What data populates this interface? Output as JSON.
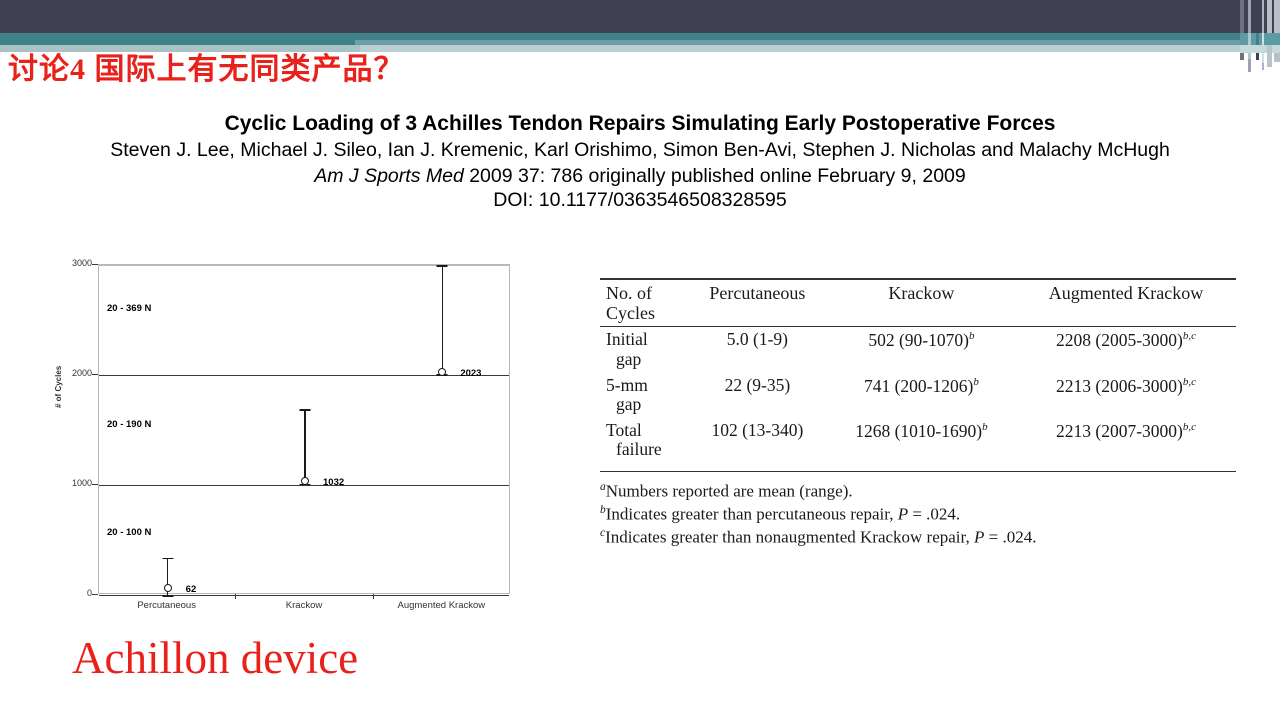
{
  "header": {
    "band_navy_color": "#3f4051",
    "band_teal_color": "#3e8189",
    "band_pale_color": "#a9c2c6"
  },
  "slide": {
    "title": "讨论4  国际上有无同类产品？",
    "title_color": "#e8211b",
    "bottom_caption": "Achillon device",
    "bottom_caption_color": "#e8211b"
  },
  "paper": {
    "title": "Cyclic Loading of 3 Achilles Tendon Repairs Simulating Early Postoperative Forces",
    "authors": "Steven J. Lee, Michael J. Sileo, Ian J. Kremenic, Karl Orishimo, Simon Ben-Avi, Stephen J. Nicholas and Malachy McHugh",
    "journal_name": "Am J Sports Med",
    "journal_rest": " 2009 37: 786 originally published online February 9, 2009",
    "doi": "DOI: 10.1177/0363546508328595"
  },
  "chart_data": {
    "type": "scatter",
    "title": "",
    "xlabel": "",
    "ylabel": "# of Cycles",
    "ylim": [
      0,
      3000
    ],
    "yticks": [
      0,
      1000,
      2000,
      3000
    ],
    "ytick_labels": [
      "0",
      "1000",
      "2000",
      "3000"
    ],
    "grid": true,
    "categories": [
      "Percutaneous",
      "Krackow",
      "Augmented Krackow"
    ],
    "values": [
      62,
      1032,
      2023
    ],
    "value_labels": [
      "62",
      "1032",
      "2023"
    ],
    "err_low": [
      0,
      1010,
      2007
    ],
    "err_high": [
      340,
      1690,
      3000
    ],
    "annotations": [
      {
        "text": "20 - 369 N",
        "y": 2600
      },
      {
        "text": "20 - 190 N",
        "y": 1550
      },
      {
        "text": "20 - 100 N",
        "y": 560
      }
    ]
  },
  "table": {
    "headers": [
      "No. of Cycles",
      "Percutaneous",
      "Krackow",
      "Augmented Krackow"
    ],
    "header_col0_line1": "No. of",
    "header_col0_line2": "Cycles",
    "rows": [
      {
        "label_line1": "Initial",
        "label_line2": "gap",
        "percutaneous": "5.0 (1-9)",
        "krackow": "502 (90-1070)",
        "krackow_sup": "b",
        "augmented": "2208 (2005-3000)",
        "augmented_sup": "b,c"
      },
      {
        "label_line1": "5-mm",
        "label_line2": "gap",
        "percutaneous": "22 (9-35)",
        "krackow": "741 (200-1206)",
        "krackow_sup": "b",
        "augmented": "2213 (2006-3000)",
        "augmented_sup": "b,c"
      },
      {
        "label_line1": "Total",
        "label_line2": "failure",
        "percutaneous": "102 (13-340)",
        "krackow": "1268 (1010-1690)",
        "krackow_sup": "b",
        "augmented": "2213 (2007-3000)",
        "augmented_sup": "b,c"
      }
    ],
    "footnotes": [
      {
        "mark": "a",
        "text_before": "Numbers reported are mean (range).",
        "ital": "",
        "text_after": ""
      },
      {
        "mark": "b",
        "text_before": "Indicates greater than percutaneous repair, ",
        "ital": "P",
        "text_after": " = .024."
      },
      {
        "mark": "c",
        "text_before": "Indicates greater than nonaugmented Krackow repair, ",
        "ital": "P",
        "text_after": " = .024."
      }
    ]
  }
}
